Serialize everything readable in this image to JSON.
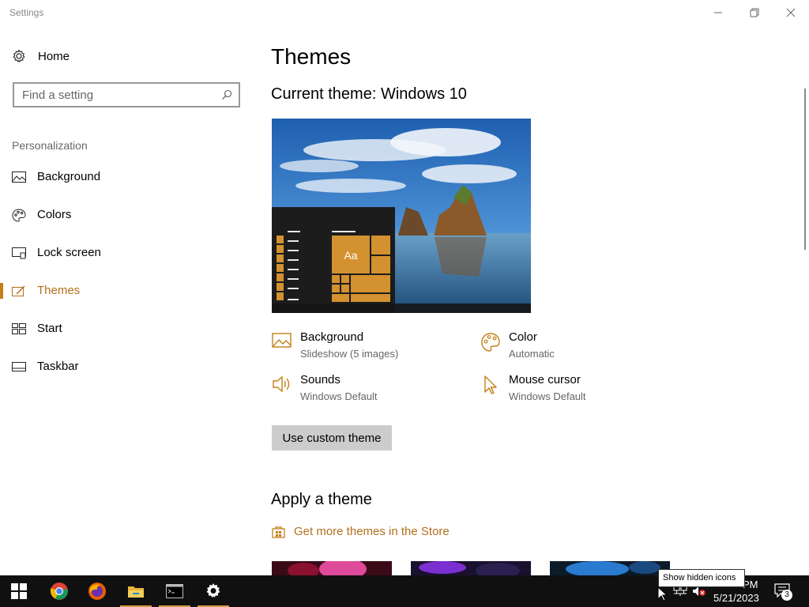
{
  "window": {
    "title": "Settings"
  },
  "sidebar": {
    "home_label": "Home",
    "search_placeholder": "Find a setting",
    "section_label": "Personalization",
    "items": [
      {
        "label": "Background",
        "icon": "picture-icon"
      },
      {
        "label": "Colors",
        "icon": "palette-icon"
      },
      {
        "label": "Lock screen",
        "icon": "monitor-icon"
      },
      {
        "label": "Themes",
        "icon": "brush-icon",
        "active": true
      },
      {
        "label": "Start",
        "icon": "start-grid-icon"
      },
      {
        "label": "Taskbar",
        "icon": "taskbar-icon"
      }
    ]
  },
  "main": {
    "title": "Themes",
    "current_theme": "Current theme: Windows 10",
    "preview_tile_label": "Aa",
    "properties": [
      {
        "title": "Background",
        "value": "Slideshow (5 images)",
        "icon": "picture-icon"
      },
      {
        "title": "Color",
        "value": "Automatic",
        "icon": "palette-icon"
      },
      {
        "title": "Sounds",
        "value": "Windows Default",
        "icon": "speaker-icon"
      },
      {
        "title": "Mouse cursor",
        "value": "Windows Default",
        "icon": "cursor-icon"
      }
    ],
    "custom_button": "Use custom theme",
    "apply_title": "Apply a theme",
    "store_link": "Get more themes in the Store"
  },
  "taskbar": {
    "apps": [
      "windows-start-icon",
      "chrome-icon",
      "firefox-icon",
      "file-explorer-icon",
      "terminal-icon",
      "settings-gear-icon"
    ],
    "tooltip": "Show hidden icons",
    "time": "PM",
    "date": "5/21/2023",
    "notification_count": "3"
  },
  "colors": {
    "accent": "#c57f16",
    "accent_text": "#b46f1c",
    "taskbar": "#101010"
  }
}
